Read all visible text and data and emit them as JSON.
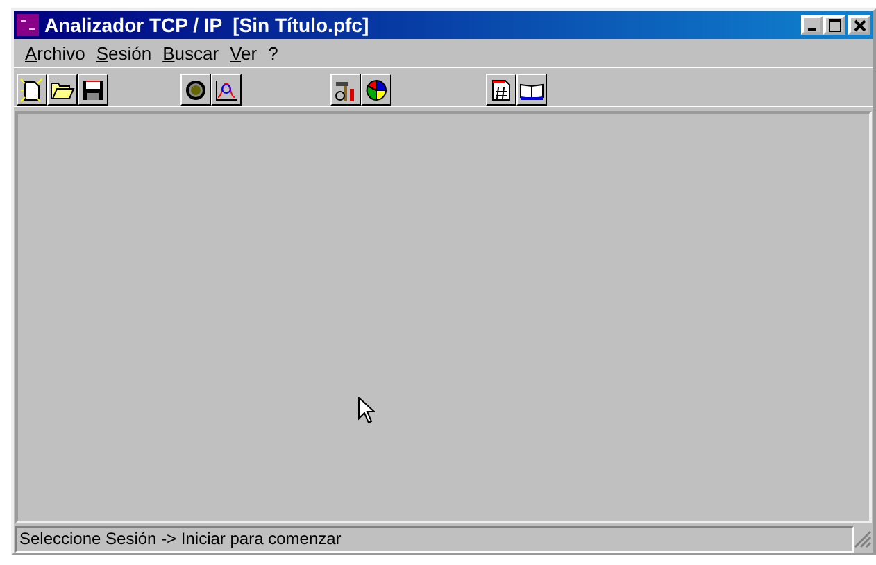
{
  "window": {
    "title": "Analizador TCP / IP  [Sin Título.pfc]",
    "controls": [
      {
        "kind": "minimize"
      },
      {
        "kind": "maximize"
      },
      {
        "kind": "close"
      }
    ]
  },
  "menu": [
    {
      "label": "Archivo"
    },
    {
      "label": "Sesión"
    },
    {
      "label": "Buscar"
    },
    {
      "label": "Ver"
    },
    {
      "label": "?"
    }
  ],
  "toolbar": [
    [
      {
        "kind": "new"
      },
      {
        "kind": "open"
      },
      {
        "kind": "save"
      }
    ],
    [
      {
        "kind": "record"
      },
      {
        "kind": "chart"
      }
    ],
    [
      {
        "kind": "tools"
      },
      {
        "kind": "pie"
      }
    ],
    [
      {
        "kind": "hashdoc"
      },
      {
        "kind": "book"
      }
    ]
  ],
  "status_bar": {
    "text": "Seleccione Sesión -> Iniciar para comenzar"
  }
}
